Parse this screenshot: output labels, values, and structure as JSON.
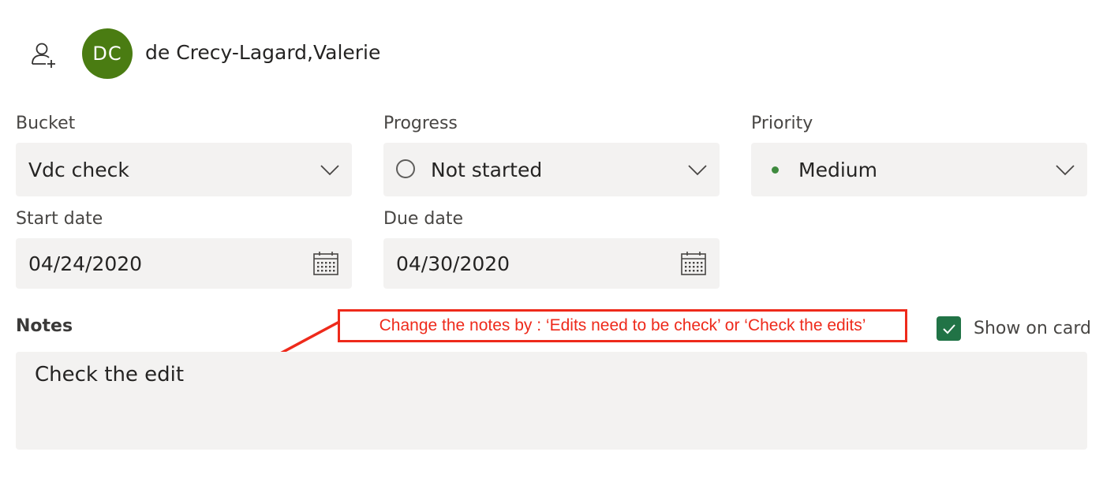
{
  "assignee": {
    "initials": "DC",
    "name": "de Crecy-Lagard,Valerie",
    "avatar_color": "#4a7c12"
  },
  "fields": {
    "bucket": {
      "label": "Bucket",
      "value": "Vdc check"
    },
    "progress": {
      "label": "Progress",
      "value": "Not started"
    },
    "priority": {
      "label": "Priority",
      "value": "Medium",
      "dot_color": "#3e8a3e"
    },
    "start_date": {
      "label": "Start date",
      "value": "04/24/2020"
    },
    "due_date": {
      "label": "Due date",
      "value": "04/30/2020"
    }
  },
  "notes": {
    "label": "Notes",
    "value": "Check the edit"
  },
  "show_on_card": {
    "label": "Show on card",
    "checked": true,
    "color": "#217346"
  },
  "annotation": {
    "text": "Change the notes by : ‘Edits need to be check’ or ‘Check the edits’",
    "color": "#ee2a1b"
  },
  "icons": {
    "assign": "add-person-icon",
    "dropdown": "chevron-down-icon",
    "calendar": "calendar-icon",
    "check": "checkmark-icon"
  }
}
